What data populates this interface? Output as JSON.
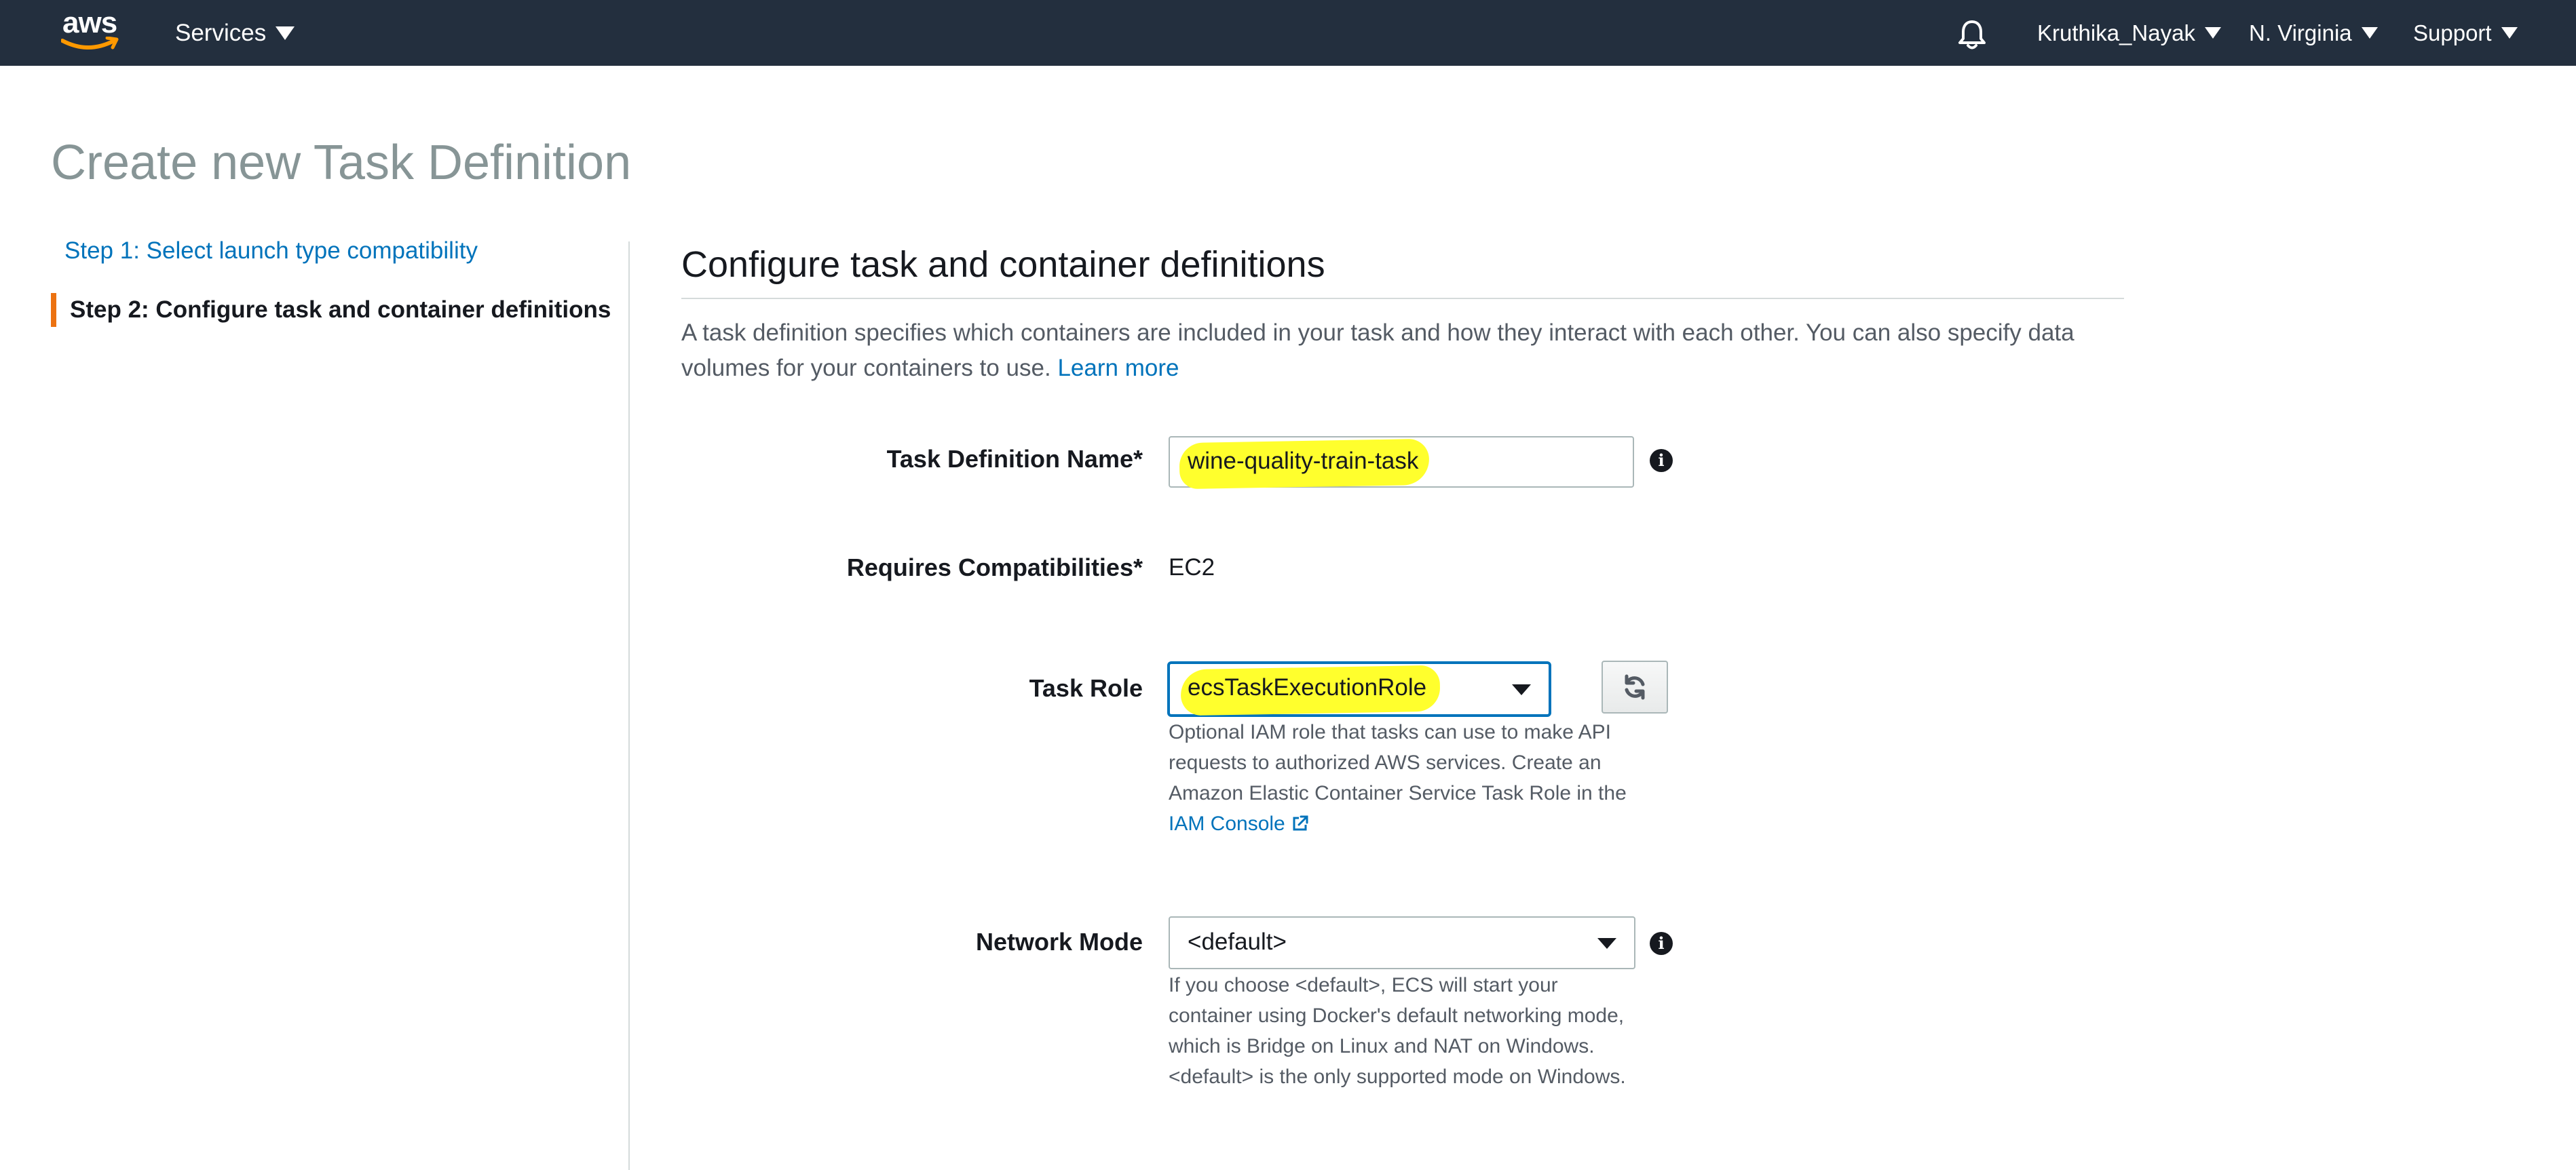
{
  "nav": {
    "logo_text": "aws",
    "services_label": "Services",
    "bell_icon": "bell-icon",
    "user_label": "Kruthika_Nayak",
    "region_label": "N. Virginia",
    "support_label": "Support"
  },
  "page": {
    "title": "Create new Task Definition"
  },
  "steps": {
    "step1": "Step 1: Select launch type compatibility",
    "step2": "Step 2: Configure task and container definitions",
    "active_accent": "#ec7211"
  },
  "main": {
    "section_title": "Configure task and container definitions",
    "description": "A task definition specifies which containers are included in your task and how they interact with each other. You can also specify data volumes for your containers to use.",
    "learn_more": "Learn more"
  },
  "form": {
    "task_def_name_label": "Task Definition Name*",
    "task_def_name_value": "wine-quality-train-task",
    "requires_compat_label": "Requires Compatibilities*",
    "requires_compat_value": "EC2",
    "task_role_label": "Task Role",
    "task_role_value": "ecsTaskExecutionRole",
    "task_role_help": "Optional IAM role that tasks can use to make API requests to authorized AWS services. Create an Amazon Elastic Container Service Task Role in the",
    "iam_console_link": "IAM Console",
    "network_mode_label": "Network Mode",
    "network_mode_value": "<default>",
    "network_mode_help": "If you choose <default>, ECS will start your container using Docker's default networking mode, which is Bridge on Linux and NAT on Windows. <default> is the only supported mode on Windows."
  },
  "colors": {
    "topbar": "#232f3e",
    "link": "#0073bb",
    "highlight": "#ffff2d"
  }
}
